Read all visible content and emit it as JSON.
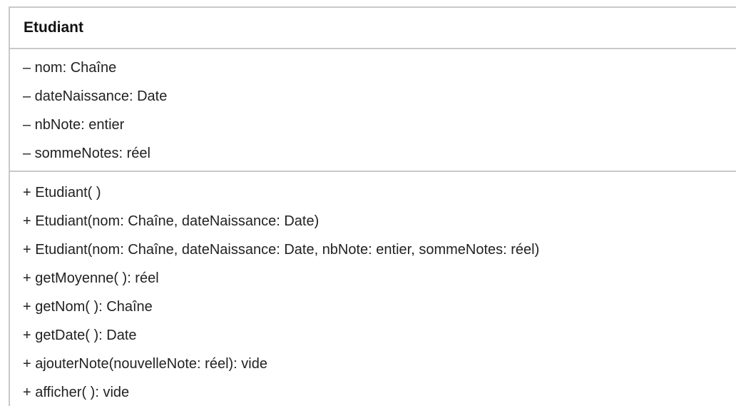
{
  "class": {
    "name": "Etudiant",
    "attributes": [
      "– nom: Chaîne",
      "– dateNaissance: Date",
      "– nbNote: entier",
      "– sommeNotes: réel"
    ],
    "methods": [
      "+ Etudiant( )",
      "+ Etudiant(nom: Chaîne, dateNaissance: Date)",
      "+ Etudiant(nom: Chaîne, dateNaissance: Date, nbNote: entier, sommeNotes: réel)",
      "+ getMoyenne( ): réel",
      "+ getNom( ): Chaîne",
      "+ getDate( ): Date",
      "+ ajouterNote(nouvelleNote: réel): vide",
      "+ afficher( ): vide"
    ]
  },
  "colors": {
    "border": "#c9c9c9",
    "text": "#222222",
    "background": "#ffffff"
  }
}
